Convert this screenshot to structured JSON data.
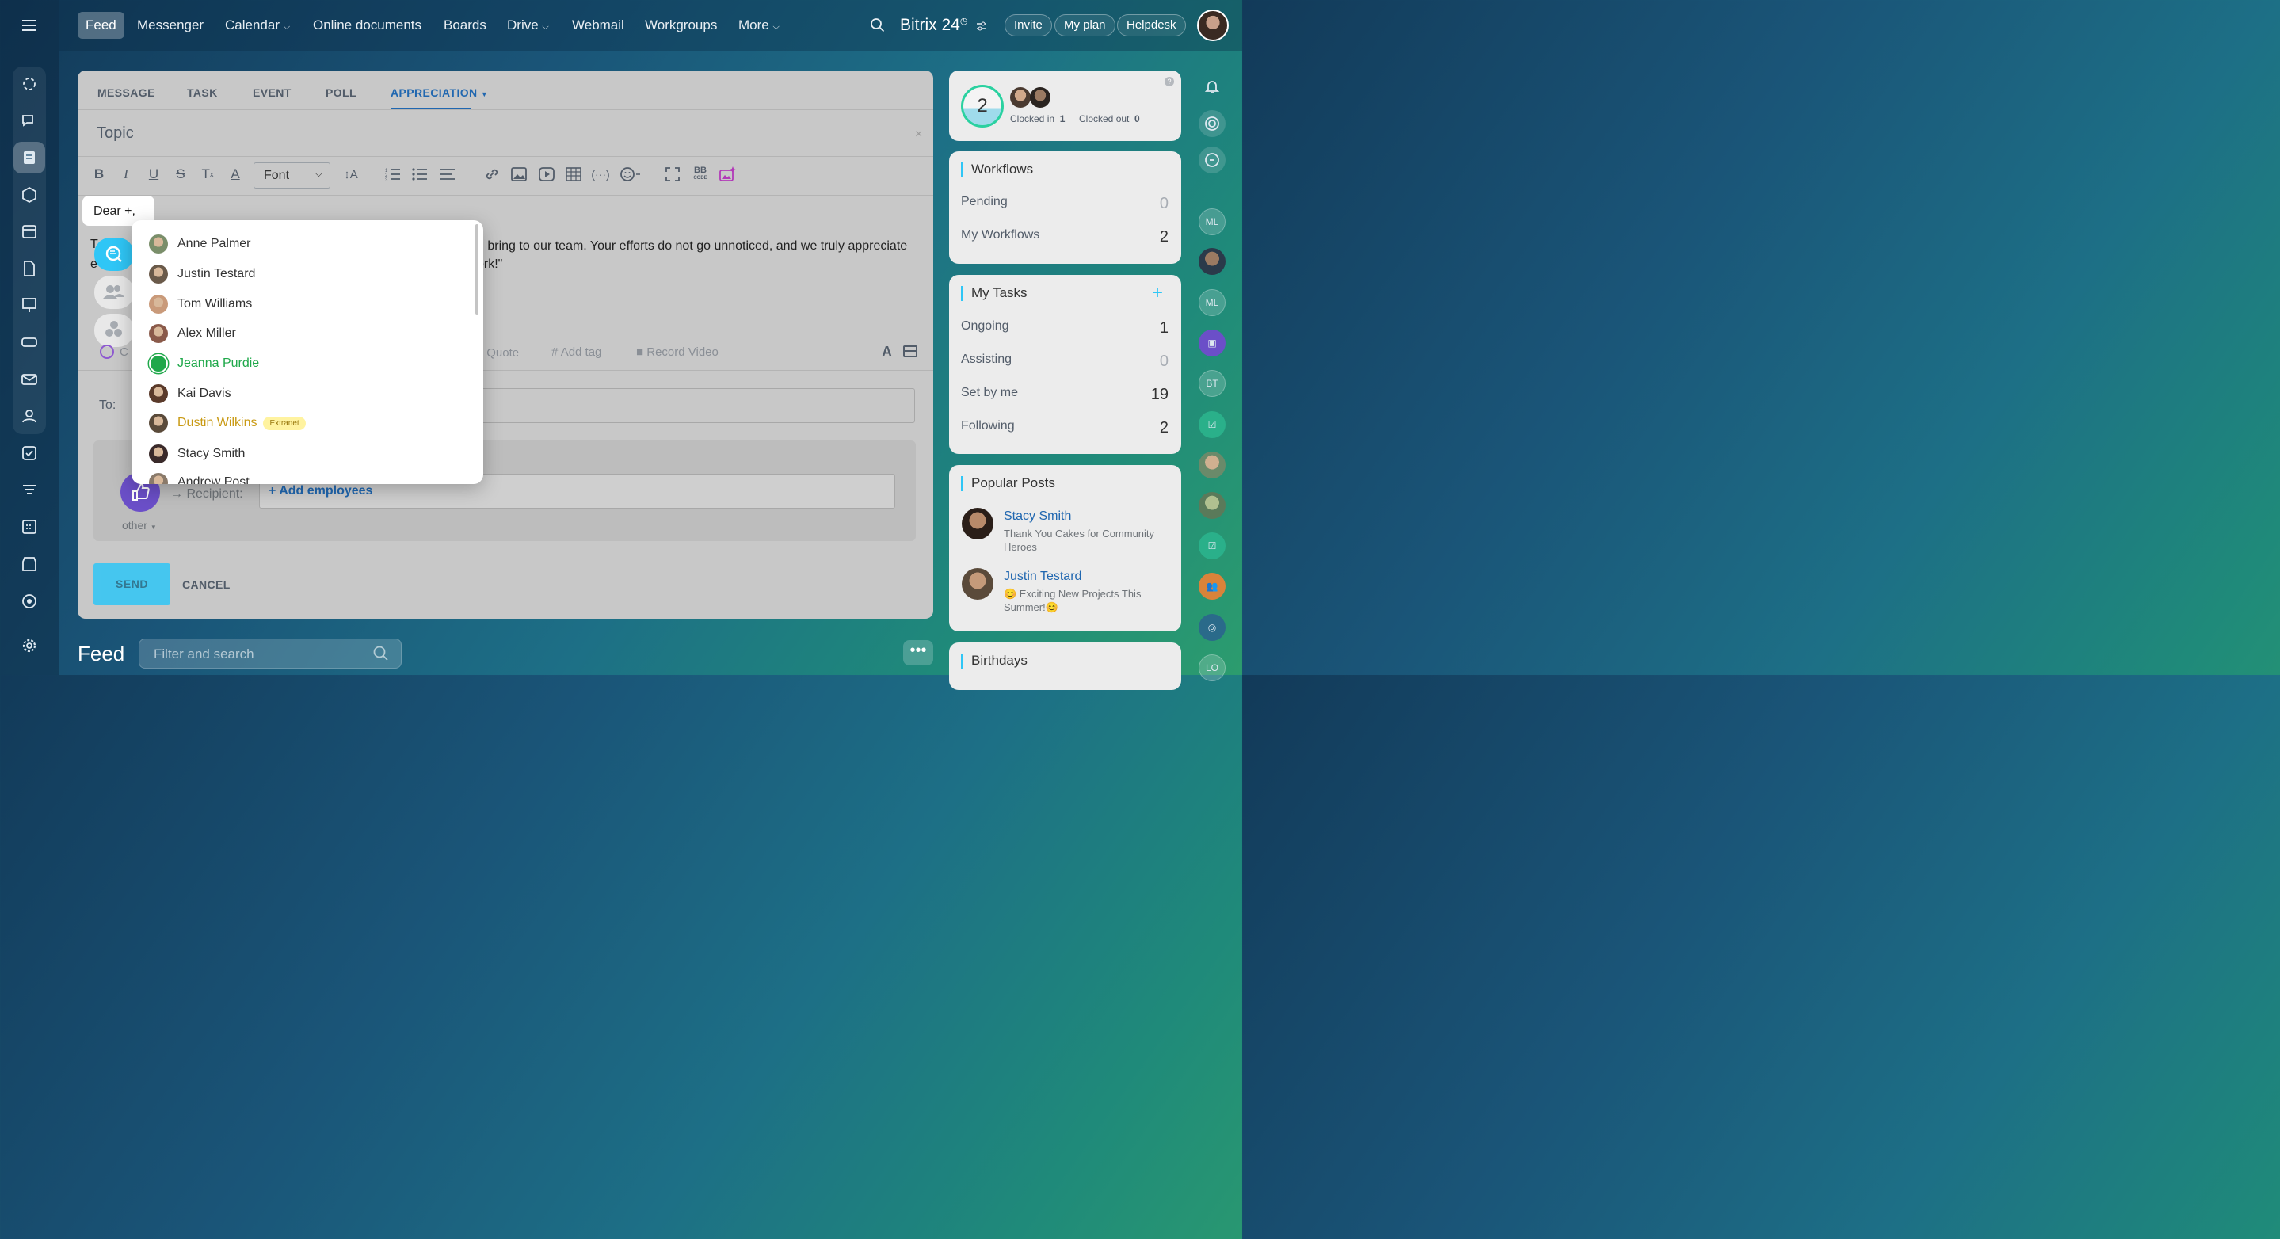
{
  "topnav": {
    "items": [
      "Feed",
      "Messenger",
      "Calendar",
      "Online documents",
      "Boards",
      "Drive",
      "Webmail",
      "Workgroups",
      "More"
    ],
    "brand": "Bitrix 24",
    "invite": "Invite",
    "plan": "My plan",
    "helpdesk": "Helpdesk"
  },
  "composer": {
    "tabs": [
      "MESSAGE",
      "TASK",
      "EVENT",
      "POLL",
      "APPRECIATION"
    ],
    "topic_placeholder": "Topic",
    "font_label": "Font",
    "dear": "Dear +,",
    "body_line1": "u bring to our team. Your efforts do not go unnoticed, and we truly appreciate",
    "body_line2": "ork!\"",
    "quote": "Quote",
    "add_tag": "Add tag",
    "record_video": "Record Video",
    "to_label": "To:",
    "recipient_label": "Recipient:",
    "add_employees": "+ Add employees",
    "other": "other",
    "send": "SEND",
    "cancel": "CANCEL"
  },
  "mention_popup": {
    "people": [
      {
        "name": "Anne Palmer",
        "style": "normal",
        "color": "#7a8e6a"
      },
      {
        "name": "Justin Testard",
        "style": "normal",
        "color": "#6a5a4a"
      },
      {
        "name": "Tom Williams",
        "style": "normal",
        "color": "#c99a7a"
      },
      {
        "name": "Alex Miller",
        "style": "normal",
        "color": "#8a5a4a"
      },
      {
        "name": "Jeanna Purdie",
        "style": "green",
        "color": "#1fa84a"
      },
      {
        "name": "Kai Davis",
        "style": "normal",
        "color": "#5a3a2a"
      },
      {
        "name": "Dustin Wilkins",
        "style": "extranet",
        "badge": "Extranet",
        "color": "#5a4a3a"
      },
      {
        "name": "Stacy Smith",
        "style": "normal",
        "color": "#3a2a2a"
      },
      {
        "name": "Andrew Post",
        "style": "cut",
        "color": "#8a7a6a"
      }
    ]
  },
  "feed": {
    "title": "Feed",
    "filter_placeholder": "Filter and search"
  },
  "timeman": {
    "count": "2",
    "clocked_in": "Clocked in",
    "clocked_in_n": "1",
    "clocked_out": "Clocked out",
    "clocked_out_n": "0"
  },
  "workflows": {
    "title": "Workflows",
    "rows": [
      {
        "label": "Pending",
        "value": "0"
      },
      {
        "label": "My Workflows",
        "value": "2"
      }
    ]
  },
  "tasks": {
    "title": "My Tasks",
    "rows": [
      {
        "label": "Ongoing",
        "value": "1"
      },
      {
        "label": "Assisting",
        "value": "0"
      },
      {
        "label": "Set by me",
        "value": "19"
      },
      {
        "label": "Following",
        "value": "2"
      }
    ]
  },
  "popular": {
    "title": "Popular Posts",
    "posts": [
      {
        "author": "Stacy Smith",
        "text": "Thank You Cakes for Community Heroes"
      },
      {
        "author": "Justin Testard",
        "text": "😊 Exciting New Projects This Summer!😊"
      }
    ]
  },
  "birthdays": {
    "title": "Birthdays"
  },
  "right_rail": {
    "initials": [
      "ML",
      "ML",
      "BT",
      "LO"
    ]
  }
}
